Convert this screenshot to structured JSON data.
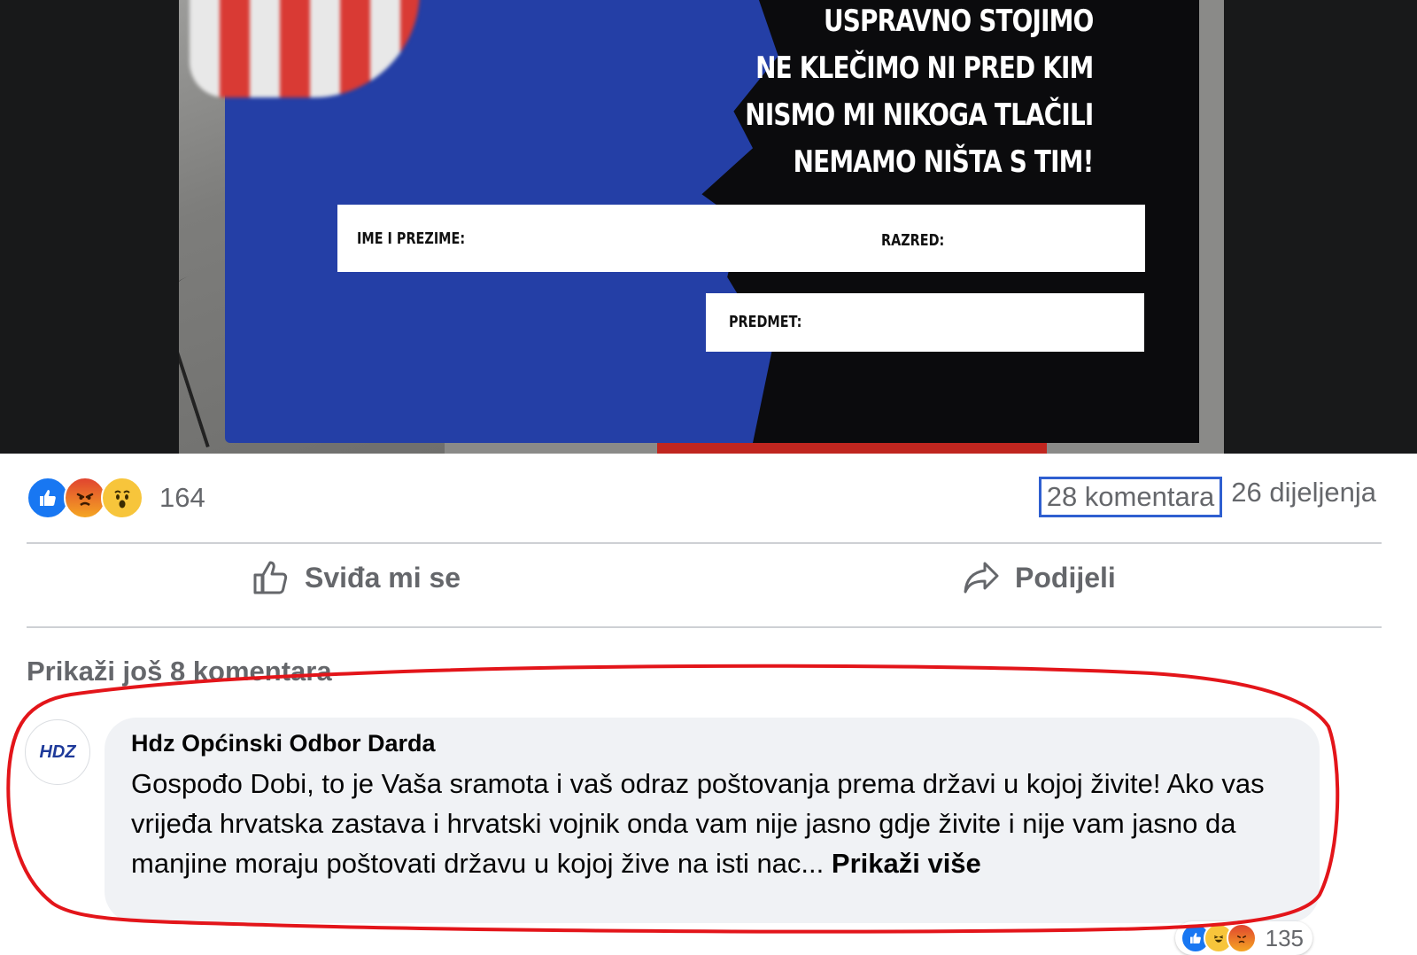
{
  "photo": {
    "slogan": [
      "USPRAVNO STOJIMO",
      "NE KLEČIMO NI PRED KIM",
      "NISMO MI NIKOGA TLAČILI",
      "NEMAMO NIŠTA S TIM!"
    ],
    "field_name": "IME I PREZIME:",
    "field_class": "RAZRED:",
    "field_subject": "PREDMET:"
  },
  "post": {
    "reaction_icons": [
      "like-icon",
      "angry-icon",
      "wow-icon"
    ],
    "reaction_count": "164",
    "comments_link": "28 komentara",
    "shares": "26 dijeljenja",
    "like_label": "Sviđa mi se",
    "share_label": "Podijeli",
    "more_comments": "Prikaži još 8 komentara"
  },
  "comment": {
    "avatar_text": "HDZ",
    "author": "Hdz Općinski Odbor Darda",
    "text": "Gospođo Dobi, to je Vaša sramota i vaš odraz poštovanja prema državi u kojoj živite! Ako vas vrijeđa hrvatska zastava i hrvatski vojnik onda vam nije jasno gdje živite i nije vam jasno da manjine moraju poštovati državu u kojoj žive na isti nac...",
    "see_more": "Prikaži više",
    "reaction_count": "135"
  },
  "colors": {
    "annotation": "#e3151a",
    "link_highlight": "#2f5fd0",
    "like_blue": "#1877f2"
  }
}
